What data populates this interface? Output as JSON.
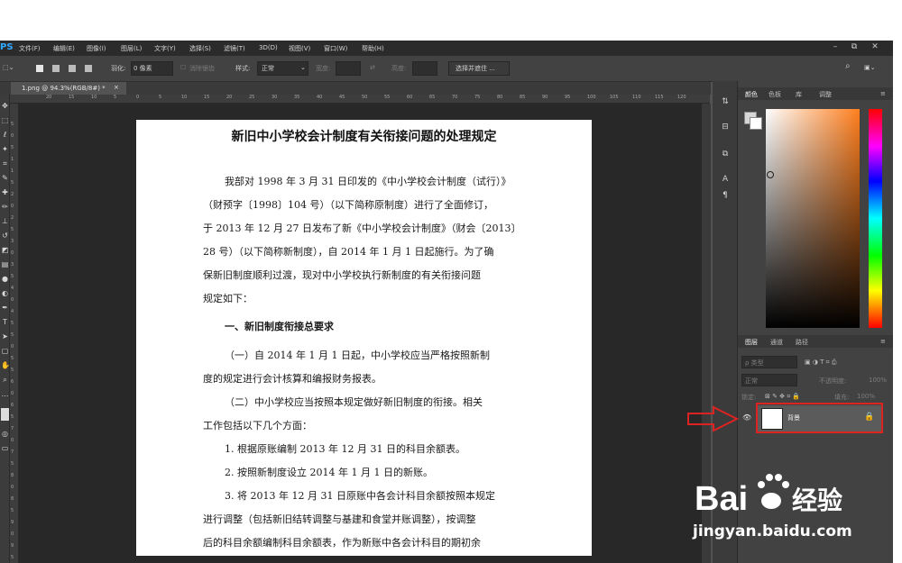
{
  "app": {
    "logo": "PS",
    "menus": [
      "文件(F)",
      "编辑(E)",
      "图像(I)",
      "图层(L)",
      "文字(Y)",
      "选择(S)",
      "滤镜(T)",
      "3D(D)",
      "视图(V)",
      "窗口(W)",
      "帮助(H)"
    ],
    "window_controls": [
      "–",
      "⧉",
      "✕"
    ]
  },
  "options": {
    "feather_label": "羽化:",
    "feather_value": "0 像素",
    "antialias_label": "消除锯齿",
    "style_label": "样式:",
    "style_value": "正常",
    "width_label": "宽度:",
    "height_label": "高度:",
    "select_mask_label": "选择并遮住 ..."
  },
  "tab": {
    "title": "1.png @ 94.3%(RGB/8#) *",
    "close": "×"
  },
  "ruler": {
    "h_ticks": [
      "20",
      "15",
      "10",
      "5",
      "0",
      "5",
      "10",
      "15",
      "20",
      "25",
      "30",
      "35",
      "40",
      "45",
      "50",
      "55",
      "60",
      "65",
      "70",
      "75",
      "80",
      "85",
      "90",
      "95",
      "100",
      "105",
      "110",
      "115",
      "120"
    ],
    "v_ticks": [
      "5",
      "0",
      "5",
      "1",
      "1",
      "5",
      "2",
      "0",
      "2",
      "5",
      "3",
      "0",
      "3",
      "5",
      "4",
      "0",
      "4",
      "5",
      "5",
      "0",
      "5",
      "5",
      "6",
      "0",
      "6",
      "5",
      "7",
      "0",
      "7",
      "5",
      "8",
      "0",
      "8",
      "5",
      "9",
      "0",
      "9",
      "5"
    ]
  },
  "document": {
    "title": "新旧中小学校会计制度有关衔接问题的处理规定",
    "lines": [
      "我部对 1998 年 3 月 31 日印发的《中小学校会计制度（试行）》",
      "（财预字〔1998〕104 号）（以下简称原制度）进行了全面修订，",
      "于 2013 年 12 月 27 日发布了新《中小学校会计制度》（财会〔2013〕",
      "28 号）（以下简称新制度），自 2014 年 1 月 1 日起施行。为了确",
      "保新旧制度顺利过渡，现对中小学校执行新制度的有关衔接问题",
      "规定如下：",
      "一、新旧制度衔接总要求",
      "（一）自 2014 年 1 月 1 日起，中小学校应当严格按照新制",
      "度的规定进行会计核算和编报财务报表。",
      "（二）中小学校应当按照本规定做好新旧制度的衔接。相关",
      "工作包括以下几个方面：",
      "1. 根据原账编制 2013 年 12 月 31 日的科目余额表。",
      "2. 按照新制度设立 2014 年 1 月 1 日的新账。",
      "3. 将 2013 年 12 月 31 日原账中各会计科目余额按照本规定",
      "进行调整（包括新旧结转调整与基建和食堂并账调整），按调整",
      "后的科目余额编制科目余额表，作为新账中各会计科目的期初余"
    ]
  },
  "color_panel": {
    "tabs": [
      "颜色",
      "色板",
      "库",
      "调整"
    ],
    "accent_color": "#ff7f1e"
  },
  "layers_panel": {
    "tabs": [
      "图层",
      "通道",
      "路径"
    ],
    "filter_label": "ρ 类型",
    "blend_mode": "正常",
    "opacity_label": "不透明度:",
    "opacity_value": "100%",
    "lock_label": "锁定:",
    "fill_label": "填充:",
    "fill_value": "100%",
    "layer_name": "背景",
    "highlight_color": "#dd2222"
  },
  "watermark": {
    "logo_text": "Bai",
    "logo_text2": "经验",
    "url": "jingyan.baidu.com"
  }
}
